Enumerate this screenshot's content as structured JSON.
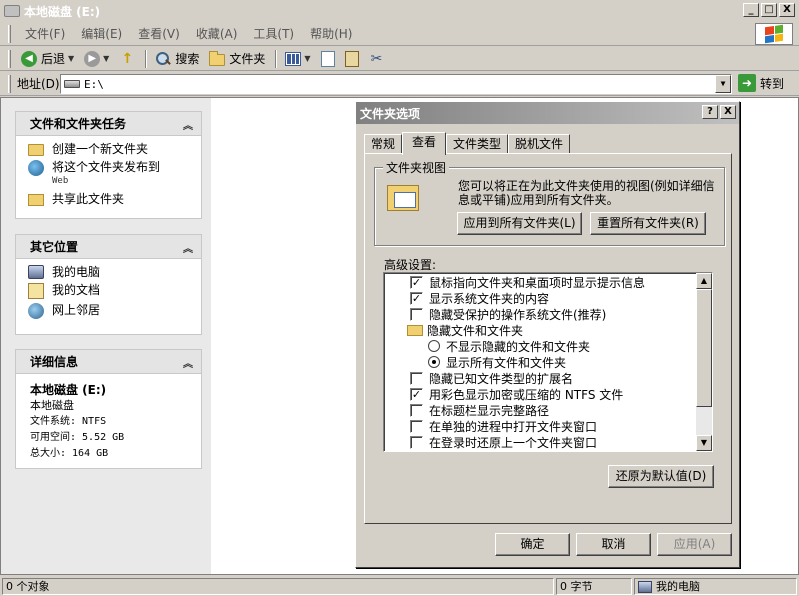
{
  "window": {
    "title": "本地磁盘 (E:)",
    "minimize": "_",
    "maximize": "□",
    "close": "X"
  },
  "menu": {
    "items": [
      "文件(F)",
      "编辑(E)",
      "查看(V)",
      "收藏(A)",
      "工具(T)",
      "帮助(H)"
    ]
  },
  "toolbar": {
    "back_label": "后退",
    "search_label": "搜索",
    "folders_label": "文件夹"
  },
  "address": {
    "label": "地址(D)",
    "value": "E:\\",
    "go_label": "转到"
  },
  "left": {
    "tasks": {
      "title": "文件和文件夹任务",
      "items": [
        {
          "label": "创建一个新文件夹",
          "icon": "new-folder-icon"
        },
        {
          "label": "将这个文件夹发布到",
          "sub": "Web",
          "icon": "web-publish-icon"
        },
        {
          "label": "共享此文件夹",
          "icon": "share-folder-icon"
        }
      ]
    },
    "places": {
      "title": "其它位置",
      "items": [
        {
          "label": "我的电脑",
          "icon": "my-computer-icon"
        },
        {
          "label": "我的文档",
          "icon": "my-documents-icon"
        },
        {
          "label": "网上邻居",
          "icon": "network-icon"
        }
      ]
    },
    "details": {
      "title": "详细信息",
      "name": "本地磁盘 (E:)",
      "type": "本地磁盘",
      "filesystem": "文件系统: NTFS",
      "free": "可用空间: 5.52 GB",
      "total": "总大小: 164 GB"
    }
  },
  "status": {
    "objects": "0 个对象",
    "size": "0 字节",
    "zone": "我的电脑"
  },
  "dialog": {
    "title": "文件夹选项",
    "help": "?",
    "close": "X",
    "tabs": [
      "常规",
      "查看",
      "文件类型",
      "脱机文件"
    ],
    "active_tab": "查看",
    "group_title": "文件夹视图",
    "group_text": "您可以将正在为此文件夹使用的视图(例如详细信息或平铺)应用到所有文件夹。",
    "apply_all": "应用到所有文件夹(L)",
    "reset_all": "重置所有文件夹(R)",
    "advanced_label": "高级设置:",
    "settings": [
      {
        "kind": "checkbox",
        "checked": true,
        "label": "鼠标指向文件夹和桌面项时显示提示信息"
      },
      {
        "kind": "checkbox",
        "checked": true,
        "label": "显示系统文件夹的内容"
      },
      {
        "kind": "checkbox",
        "checked": false,
        "label": "隐藏受保护的操作系统文件(推荐)"
      },
      {
        "kind": "folder",
        "label": "隐藏文件和文件夹"
      },
      {
        "kind": "radio",
        "checked": false,
        "label": "不显示隐藏的文件和文件夹"
      },
      {
        "kind": "radio",
        "checked": true,
        "label": "显示所有文件和文件夹"
      },
      {
        "kind": "checkbox",
        "checked": false,
        "label": "隐藏已知文件类型的扩展名"
      },
      {
        "kind": "checkbox",
        "checked": true,
        "label": "用彩色显示加密或压缩的 NTFS 文件"
      },
      {
        "kind": "checkbox",
        "checked": false,
        "label": "在标题栏显示完整路径"
      },
      {
        "kind": "checkbox",
        "checked": false,
        "label": "在单独的进程中打开文件夹窗口"
      },
      {
        "kind": "checkbox",
        "checked": false,
        "label": "在登录时还原上一个文件夹窗口"
      }
    ],
    "restore_defaults": "还原为默认值(D)",
    "ok": "确定",
    "cancel": "取消",
    "apply": "应用(A)"
  }
}
